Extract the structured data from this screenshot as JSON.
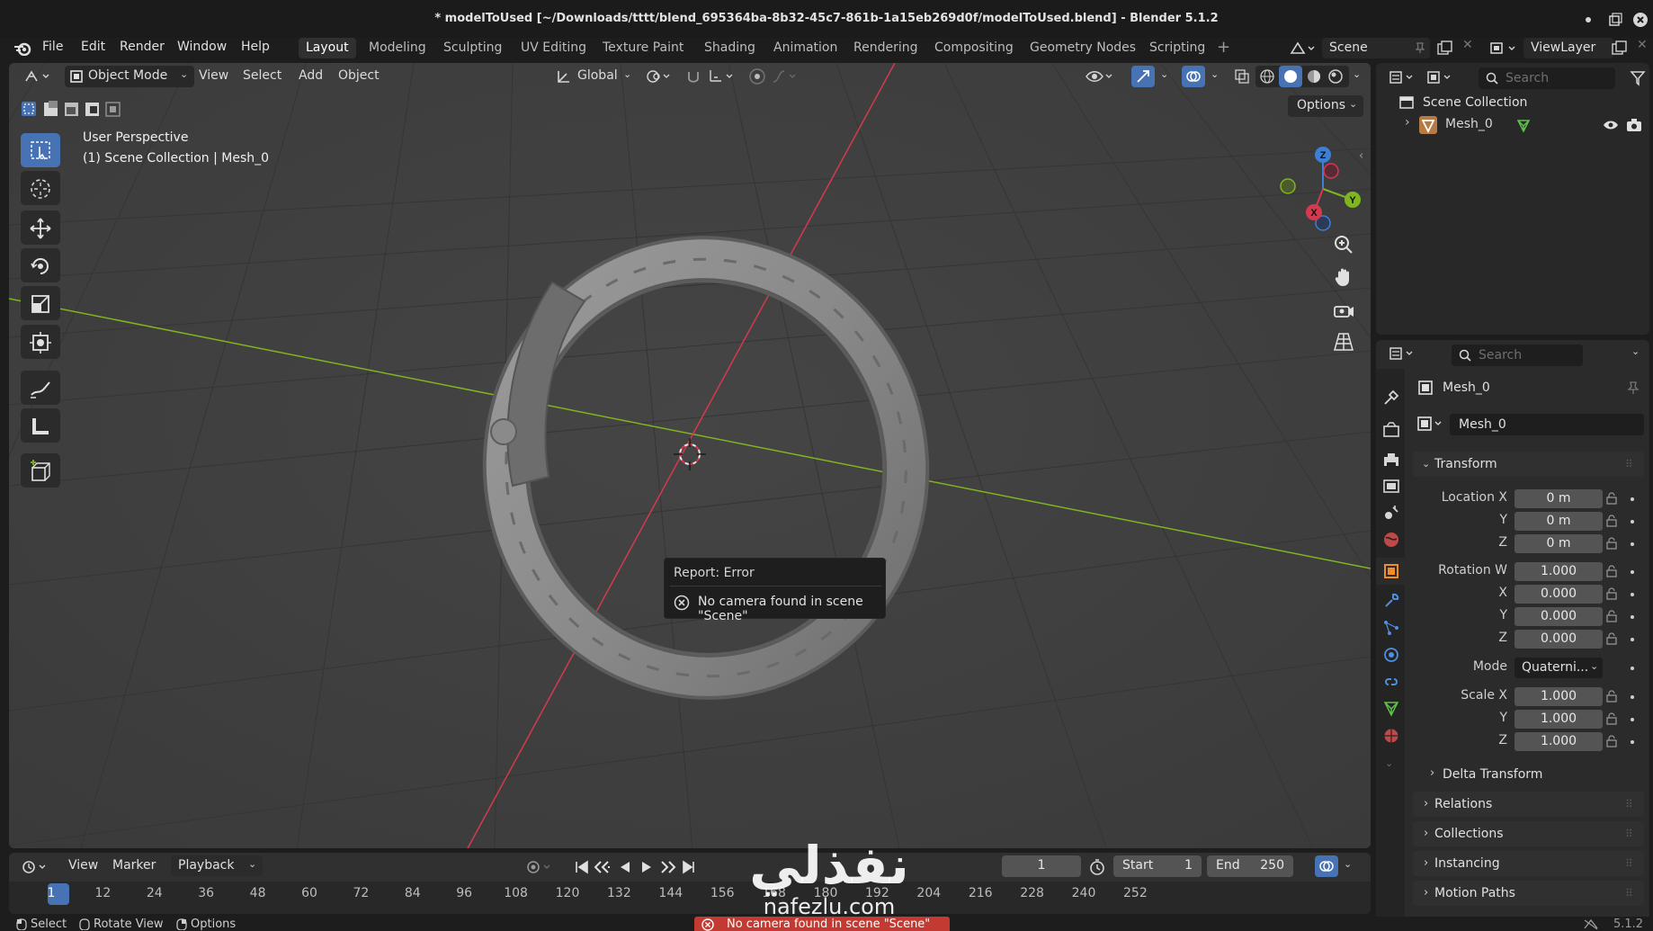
{
  "window": {
    "title": "* modelToUsed [~/Downloads/tttt/blend_695364ba-8b32-45c7-861b-1a15eb269d0f/modelToUsed.blend] - Blender 5.1.2"
  },
  "menu": [
    "File",
    "Edit",
    "Render",
    "Window",
    "Help"
  ],
  "workspaces": [
    "Layout",
    "Modeling",
    "Sculpting",
    "UV Editing",
    "Texture Paint",
    "Shading",
    "Animation",
    "Rendering",
    "Compositing",
    "Geometry Nodes",
    "Scripting"
  ],
  "scene_name": "Scene",
  "view_layer": "ViewLayer",
  "viewport": {
    "mode": "Object Mode",
    "menus": [
      "View",
      "Select",
      "Add",
      "Object"
    ],
    "orientation": "Global",
    "options_label": "Options",
    "perspective_label": "User Perspective",
    "collection_label": "(1) Scene Collection | Mesh_0"
  },
  "gizmo": {
    "x": "X",
    "y": "Y",
    "z": "Z"
  },
  "error_report": {
    "title": "Report: Error",
    "message": "No camera found in scene \"Scene\""
  },
  "outliner": {
    "search_placeholder": "Search",
    "root": "Scene Collection",
    "items": [
      {
        "label": "Mesh_0"
      }
    ]
  },
  "properties": {
    "search_placeholder": "Search",
    "object_name": "Mesh_0",
    "object_field": "Mesh_0",
    "transform": {
      "title": "Transform",
      "location_label": "Location X",
      "location": [
        "0 m",
        "0 m",
        "0 m"
      ],
      "rotation_label": "Rotation W",
      "rotation": [
        "1.000",
        "0.000",
        "0.000",
        "0.000"
      ],
      "mode_label": "Mode",
      "mode_value": "Quaterni...",
      "scale_label": "Scale X",
      "scale": [
        "1.000",
        "1.000",
        "1.000"
      ],
      "axis_labels": [
        "Y",
        "Z",
        "X"
      ]
    },
    "delta_transform": "Delta Transform",
    "panels": [
      "Relations",
      "Collections",
      "Instancing",
      "Motion Paths"
    ]
  },
  "timeline": {
    "menus": [
      "View",
      "Marker",
      "Playback"
    ],
    "current_frame": "1",
    "start_label": "Start",
    "start": "1",
    "end_label": "End",
    "end": "250",
    "ticks": [
      "1",
      "12",
      "24",
      "36",
      "48",
      "60",
      "72",
      "84",
      "96",
      "108",
      "120",
      "132",
      "144",
      "156",
      "168",
      "180",
      "192",
      "204",
      "216",
      "228",
      "240",
      "252"
    ]
  },
  "watermark": {
    "arabic": "نفذلي",
    "latin": "nafezlu.com"
  },
  "statusbar": {
    "select": "Select",
    "rotate": "Rotate View",
    "options": "Options",
    "error": "No camera found in scene \"Scene\"",
    "version": "5.1.2"
  },
  "colors": {
    "accent": "#4772b3",
    "x_axis": "#d43a4e",
    "y_axis": "#7fb51f",
    "z_axis": "#3c80d6",
    "error": "#c33a33"
  }
}
